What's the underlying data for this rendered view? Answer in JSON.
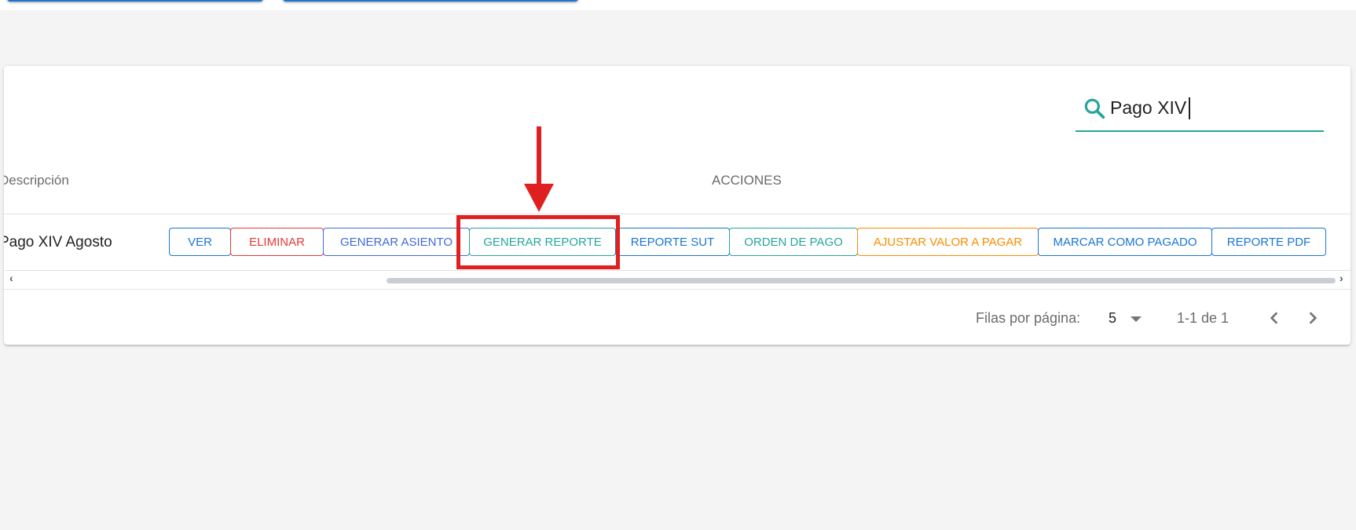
{
  "search": {
    "value": "Pago XIV"
  },
  "table": {
    "headers": {
      "description": "Descripción",
      "actions": "ACCIONES"
    },
    "rows": [
      {
        "description": "Pago XIV Agosto",
        "actions": {
          "view": "VER",
          "delete": "ELIMINAR",
          "generate_entry": "GENERAR ASIENTO",
          "generate_report": "GENERAR REPORTE",
          "sut_report": "REPORTE SUT",
          "payment_order": "ORDEN DE PAGO",
          "adjust_amount": "AJUSTAR VALOR A PAGAR",
          "mark_paid": "MARCAR COMO PAGADO",
          "pdf_report": "REPORTE PDF"
        }
      }
    ]
  },
  "footer": {
    "rows_per_page_label": "Filas por página:",
    "rows_per_page_value": "5",
    "range": "1-1 de 1"
  },
  "scrollbar": {
    "left_arrow": "‹",
    "right_arrow": "›"
  },
  "colors": {
    "accent_teal": "#26a69a",
    "primary_blue": "#1976d2",
    "danger_red": "#e53935",
    "warning_orange": "#fb8c00",
    "annotation_red": "#e02020"
  },
  "icons": [
    "search-icon",
    "chevron-down-icon",
    "chevron-left-icon",
    "chevron-right-icon",
    "down-arrow-icon"
  ]
}
